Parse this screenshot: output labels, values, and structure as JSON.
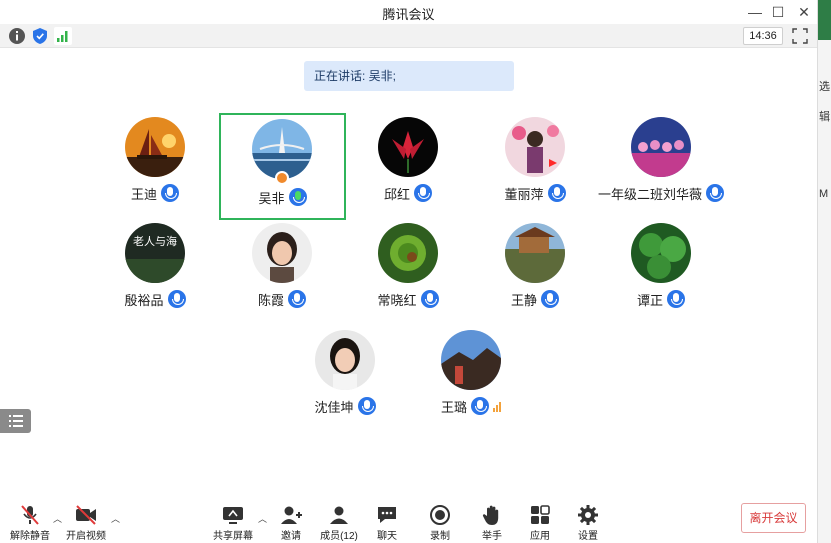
{
  "window": {
    "title": "腾讯会议",
    "minimize_glyph": "—",
    "maximize_glyph": "☐",
    "close_glyph": "✕"
  },
  "status": {
    "time": "14:36",
    "icons": [
      "info-icon",
      "shield-icon",
      "signal-bars-icon"
    ]
  },
  "banner": {
    "speaking_text": "正在讲话: 吴非;"
  },
  "participants": [
    {
      "name": "王迪"
    },
    {
      "name": "吴非"
    },
    {
      "name": "邱红"
    },
    {
      "name": "董丽萍"
    },
    {
      "name": "一年级二班刘华薇"
    },
    {
      "name": "殷裕品"
    },
    {
      "name": "陈霞"
    },
    {
      "name": "常晓红"
    },
    {
      "name": "王静"
    },
    {
      "name": "谭正"
    },
    {
      "name": "沈佳坤"
    },
    {
      "name": "王璐"
    }
  ],
  "avatar_text": {
    "yin": "老人与海"
  },
  "toolbar": {
    "unmute": "解除静音",
    "start_video": "开启视频",
    "share_screen": "共享屏幕",
    "invite": "邀请",
    "members": "成员(12)",
    "chat": "聊天",
    "record": "录制",
    "raise_hand": "举手",
    "apps": "应用",
    "settings": "设置",
    "leave": "离开会议"
  },
  "background_window": {
    "text1": "选",
    "text2": "辑",
    "text3": "M"
  },
  "colors": {
    "accent_blue": "#2a74e8",
    "active_border": "#2fb45a",
    "leave_red": "#d83b3b",
    "banner_bg": "#dce9fb"
  }
}
